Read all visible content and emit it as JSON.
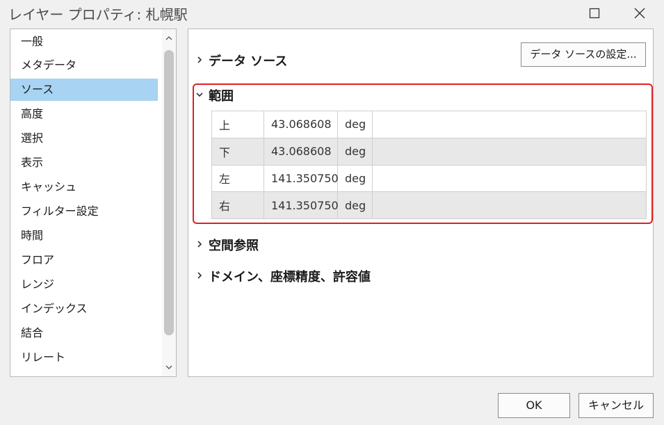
{
  "window": {
    "title": "レイヤー プロパティ: 札幌駅",
    "maximize_icon": "maximize-icon",
    "close_icon": "close-icon"
  },
  "sidebar": {
    "items": [
      {
        "label": "一般"
      },
      {
        "label": "メタデータ"
      },
      {
        "label": "ソース",
        "selected": true
      },
      {
        "label": "高度"
      },
      {
        "label": "選択"
      },
      {
        "label": "表示"
      },
      {
        "label": "キャッシュ"
      },
      {
        "label": "フィルター設定"
      },
      {
        "label": "時間"
      },
      {
        "label": "フロア"
      },
      {
        "label": "レンジ"
      },
      {
        "label": "インデックス"
      },
      {
        "label": "結合"
      },
      {
        "label": "リレート"
      }
    ],
    "selected_color": "#a8d3f2"
  },
  "main": {
    "sections": [
      {
        "title": "データ ソース",
        "expanded": false
      },
      {
        "title": "範囲",
        "expanded": true
      },
      {
        "title": "空間参照",
        "expanded": false
      },
      {
        "title": "ドメイン、座標精度、許容値",
        "expanded": false
      }
    ],
    "datasource_button": "データ ソースの設定...",
    "extent": {
      "rows": [
        {
          "label": "上",
          "value": "43.068608",
          "unit": "deg"
        },
        {
          "label": "下",
          "value": "43.068608",
          "unit": "deg"
        },
        {
          "label": "左",
          "value": "141.350750",
          "unit": "deg"
        },
        {
          "label": "右",
          "value": "141.350750",
          "unit": "deg"
        }
      ],
      "highlight_color": "#e02020"
    }
  },
  "buttons": {
    "ok": "OK",
    "cancel": "キャンセル"
  }
}
